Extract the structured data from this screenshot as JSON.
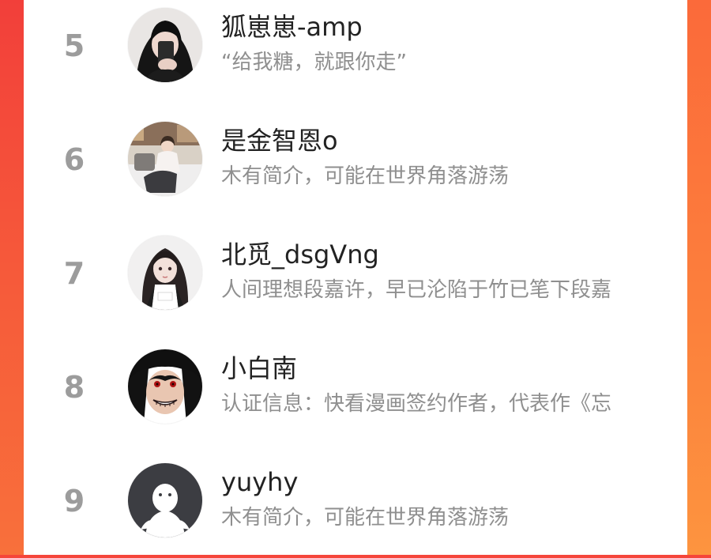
{
  "theme": {
    "accent_left": "#f5453a",
    "accent_right": "#fd943f",
    "rank_color": "#9c9c9c",
    "name_color": "#222222",
    "bio_color": "#8f8f8f"
  },
  "ranking": [
    {
      "rank": "5",
      "name": "狐崽崽-amp",
      "bio": "“给我糖，就跟你走”",
      "avatar": "avatar-girl-phone-selfie"
    },
    {
      "rank": "6",
      "name": "是金智恩o",
      "bio": "木有简介，可能在世界角落游荡",
      "avatar": "avatar-girl-sitting-room"
    },
    {
      "rank": "7",
      "name": "北觅_dsgVng",
      "bio": "人间理想段嘉许，早已沦陷于竹已笔下段嘉",
      "avatar": "avatar-anime-girl-illustration"
    },
    {
      "rank": "8",
      "name": "小白南",
      "bio": "认证信息：快看漫画签约作者，代表作《忘",
      "avatar": "avatar-anime-grinning-character"
    },
    {
      "rank": "9",
      "name": "yuyhy",
      "bio": "木有简介，可能在世界角落游荡",
      "avatar": "avatar-default-ghost"
    }
  ]
}
